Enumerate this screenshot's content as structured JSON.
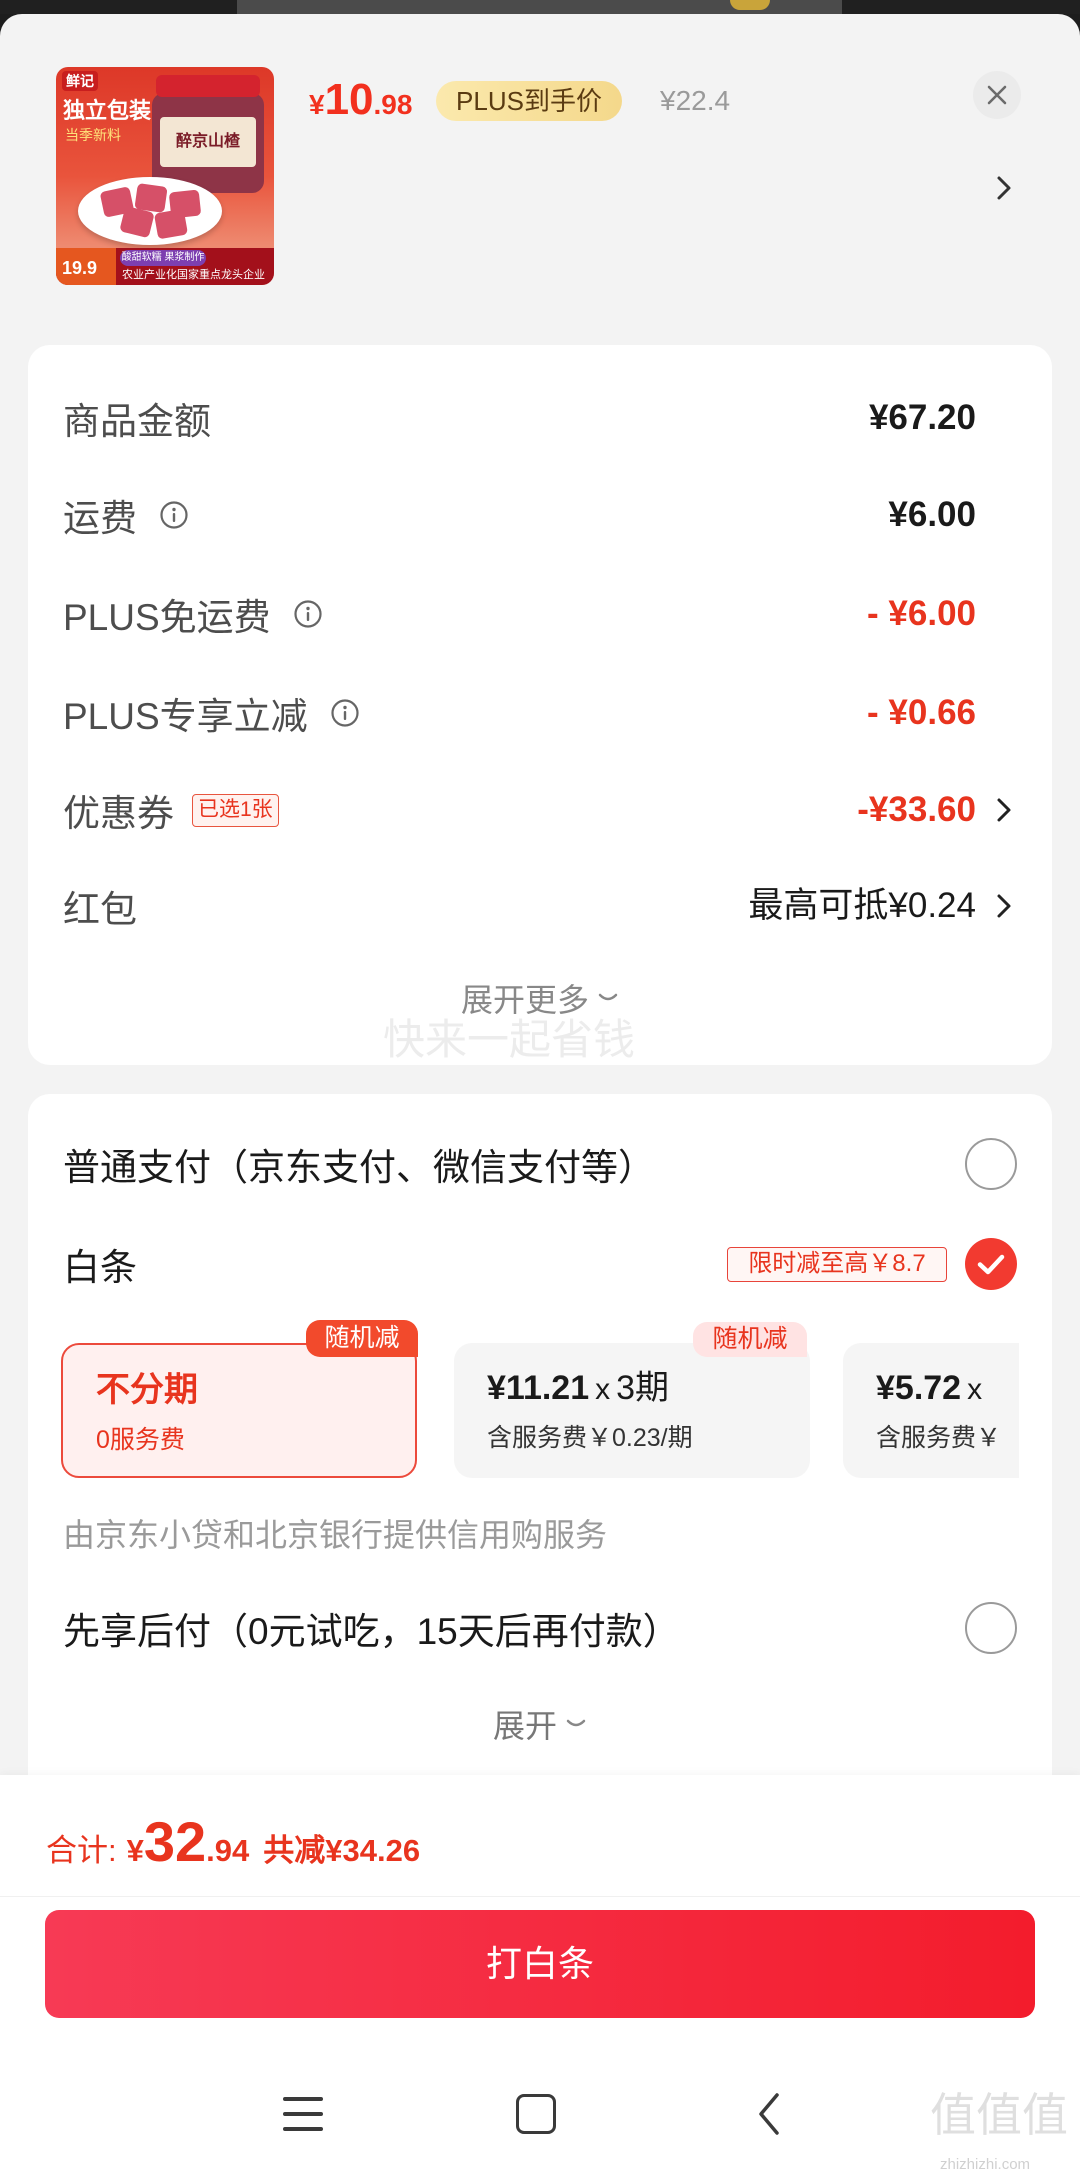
{
  "theme": {
    "accent": "#e8341e",
    "price_red": "#f2301e",
    "button_start": "#f73a55",
    "button_end": "#f31c2c",
    "plus_gold": "#f8e2a2",
    "sheet_bg": "#f3f3f3"
  },
  "icons": {
    "close": "close-icon",
    "header_more": "chevron-right-icon",
    "info": "info-icon",
    "row_more": "chevron-right-icon",
    "expand": "chevron-down-icon",
    "checked": "check-icon",
    "nav_menu": "menu-icon",
    "nav_home": "home-square-icon",
    "nav_back": "back-icon"
  },
  "product": {
    "image": {
      "brand": "鲜记",
      "headline": "独立包装",
      "subline": "当季新料",
      "jar_label": "醉京山楂",
      "price_tag": "19.9",
      "feature_pill": "酸甜软糯 果浆制作",
      "footer": "农业产业化国家重点龙头企业"
    },
    "price_symbol": "¥",
    "price_int": "10",
    "price_dec": ".98",
    "plus_label": "PLUS到手价",
    "original_price": "¥22.4"
  },
  "price_breakdown": {
    "rows": [
      {
        "label": "商品金额",
        "value": "¥67.20"
      },
      {
        "label": "运费",
        "value": "¥6.00"
      },
      {
        "label": "PLUS免运费",
        "value": "- ¥6.00"
      },
      {
        "label": "PLUS专享立减",
        "value": "- ¥0.66"
      },
      {
        "label": "优惠券",
        "badge": "已选1张",
        "value": "-¥33.60"
      },
      {
        "label": "红包",
        "value": "最高可抵¥0.24"
      }
    ],
    "expand_label": "展开更多",
    "watermark": "快来一起省钱"
  },
  "payment": {
    "normal": {
      "label": "普通支付（京东支付、微信支付等）",
      "selected": false
    },
    "baitiao": {
      "label": "白条",
      "badge": "限时减至高￥8.7",
      "selected": true
    },
    "installments": [
      {
        "title": "不分期",
        "subtitle": "0服务费",
        "tag": "随机减",
        "selected": true
      },
      {
        "amount": "¥11.21",
        "times": "x",
        "periods": "3期",
        "subtitle": "含服务费￥0.23/期",
        "tag": "随机减",
        "selected": false
      },
      {
        "amount": "¥5.72",
        "times": "x",
        "subtitle": "含服务费￥",
        "selected": false
      }
    ],
    "credit_note": "由京东小贷和北京银行提供信用购服务",
    "deferred": {
      "label": "先享后付（0元试吃，15天后再付款）",
      "selected": false
    },
    "expand_label": "展开"
  },
  "footer": {
    "total_label": "合计:",
    "total_currency": "¥",
    "total_int": "32",
    "total_dec": ".94",
    "saving": "共减¥34.26",
    "submit_label": "打白条"
  },
  "watermark": {
    "logo": "值值值",
    "site": "zhizhizhi.com"
  }
}
